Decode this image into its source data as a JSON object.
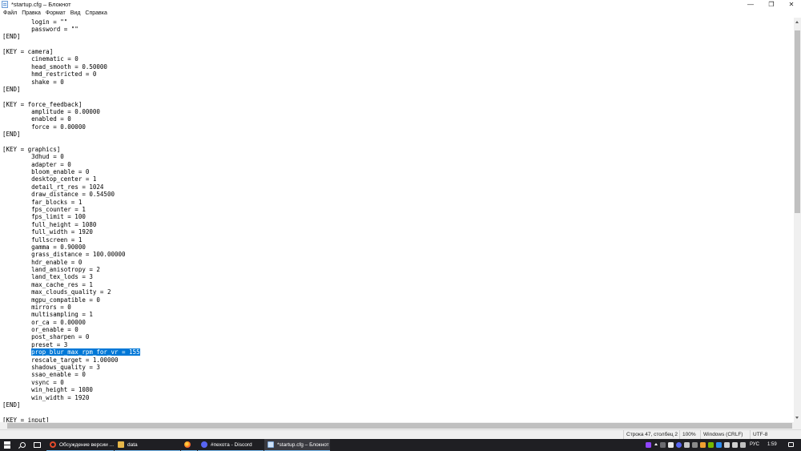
{
  "window": {
    "title": "*startup.cfg – Блокнот",
    "minimize_glyph": "—",
    "maximize_glyph": "❐",
    "close_glyph": "✕"
  },
  "menu": {
    "items": [
      "Файл",
      "Правка",
      "Формат",
      "Вид",
      "Справка"
    ]
  },
  "editor": {
    "lines": [
      "        login = \"\"",
      "        password = \"\"",
      "[END]",
      "",
      "[KEY = camera]",
      "        cinematic = 0",
      "        head_smooth = 0.50000",
      "        hmd_restricted = 0",
      "        shake = 0",
      "[END]",
      "",
      "[KEY = force_feedback]",
      "        amplitude = 0.00000",
      "        enabled = 0",
      "        force = 0.00000",
      "[END]",
      "",
      "[KEY = graphics]",
      "        3dhud = 0",
      "        adapter = 0",
      "        bloom_enable = 0",
      "        desktop_center = 1",
      "        detail_rt_res = 1024",
      "        draw_distance = 0.54500",
      "        far_blocks = 1",
      "        fps_counter = 1",
      "        fps_limit = 100",
      "        full_height = 1080",
      "        full_width = 1920",
      "        fullscreen = 1",
      "        gamma = 0.90000",
      "        grass_distance = 100.00000",
      "        hdr_enable = 0",
      "        land_anisotropy = 2",
      "        land_tex_lods = 3",
      "        max_cache_res = 1",
      "        max_clouds_quality = 2",
      "        mgpu_compatible = 0",
      "        mirrors = 0",
      "        multisampling = 1",
      "        or_ca = 0.00000",
      "        or_enable = 0",
      "        post_sharpen = 0",
      "        preset = 3",
      "SELECTED",
      "        rescale_target = 1.00000",
      "        shadows_quality = 3",
      "        ssao_enable = 0",
      "        vsync = 0",
      "        win_height = 1080",
      "        win_width = 1920",
      "[END]",
      "",
      "[KEY = input]"
    ],
    "selected_line_indent": "        ",
    "selected_text": "prop_blur_max_rpm_for_vr = 155"
  },
  "status": {
    "position": "Строка 47, столбец 2",
    "zoom": "100%",
    "line_endings": "Windows (CRLF)",
    "encoding": "UTF-8"
  },
  "taskbar": {
    "apps": [
      {
        "name": "opera",
        "label": "Обсуждение версии ..."
      },
      {
        "name": "folder",
        "label": "data"
      },
      {
        "name": "firefox",
        "label": ""
      },
      {
        "name": "discord",
        "label": "#пехота - Discord"
      },
      {
        "name": "notepad",
        "label": "*startup.cfg – Блокнот"
      }
    ],
    "language": "РУС",
    "time": "1:59"
  },
  "colors": {
    "selection": "#0078d7",
    "taskbar": "#1f1f23"
  }
}
